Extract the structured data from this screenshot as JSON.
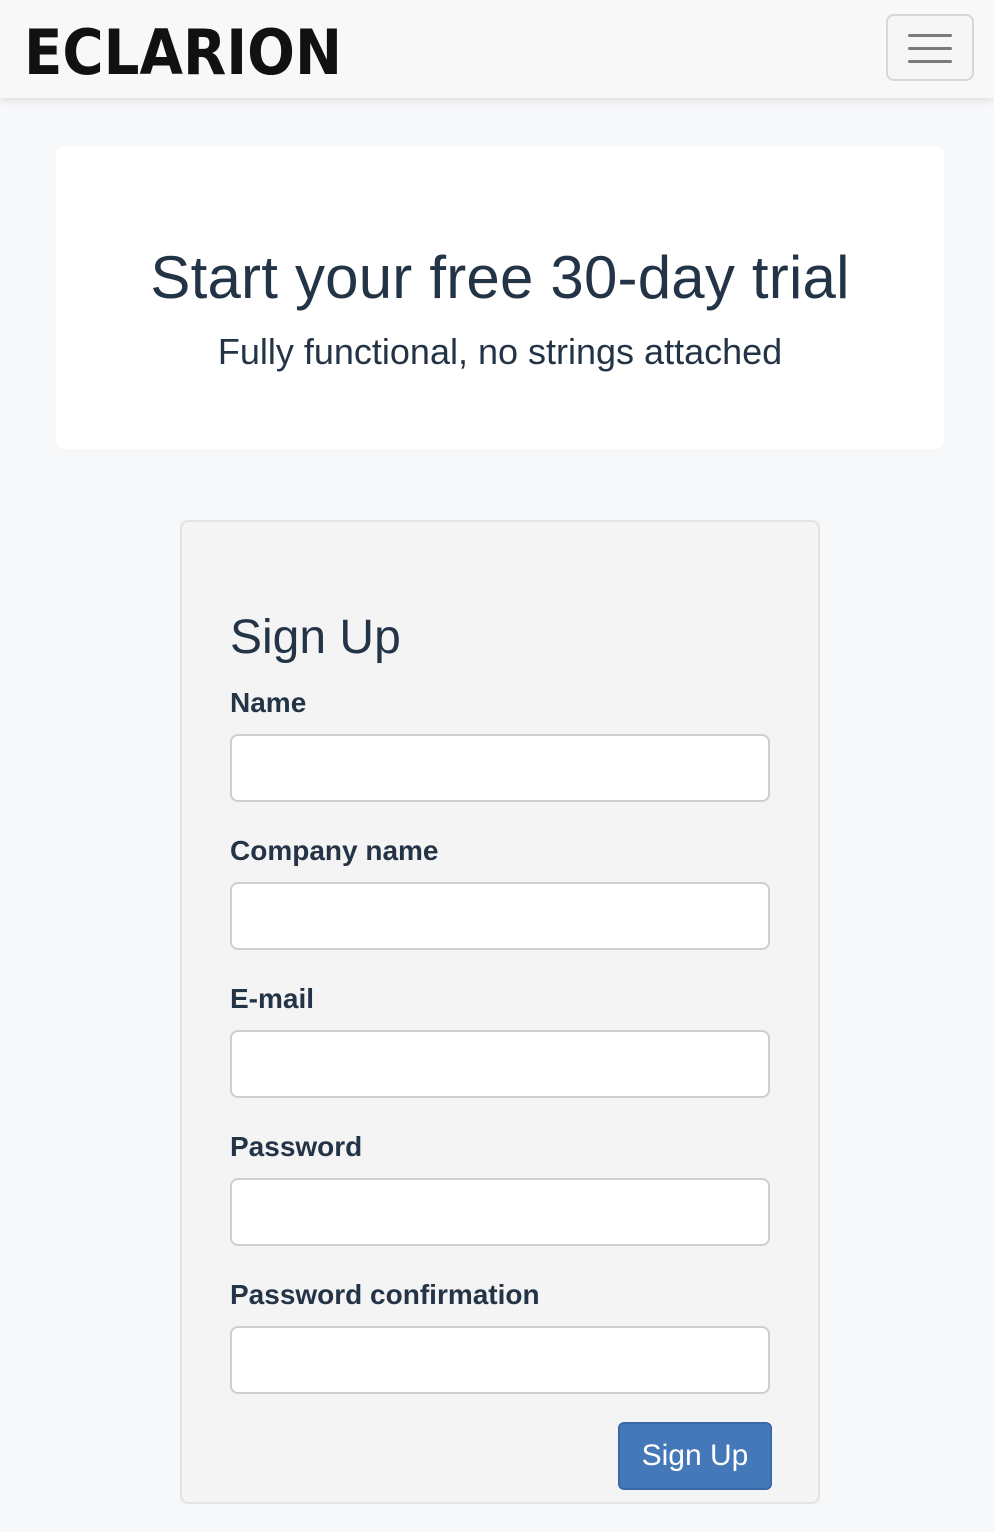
{
  "navbar": {
    "logo_text": "ECLARION",
    "menu_icon": "hamburger-menu-icon"
  },
  "hero": {
    "title": "Start your free 30-day trial",
    "subtitle": "Fully functional, no strings attached"
  },
  "signup": {
    "title": "Sign Up",
    "fields": [
      {
        "label": "Name",
        "value": "",
        "placeholder": ""
      },
      {
        "label": "Company name",
        "value": "",
        "placeholder": ""
      },
      {
        "label": "E-mail",
        "value": "",
        "placeholder": ""
      },
      {
        "label": "Password",
        "value": "",
        "placeholder": ""
      },
      {
        "label": "Password confirmation",
        "value": "",
        "placeholder": ""
      }
    ],
    "submit_label": "Sign Up"
  },
  "colors": {
    "text": "#243447",
    "button": "#4478b8",
    "page_bg": "#f7f8fa"
  }
}
